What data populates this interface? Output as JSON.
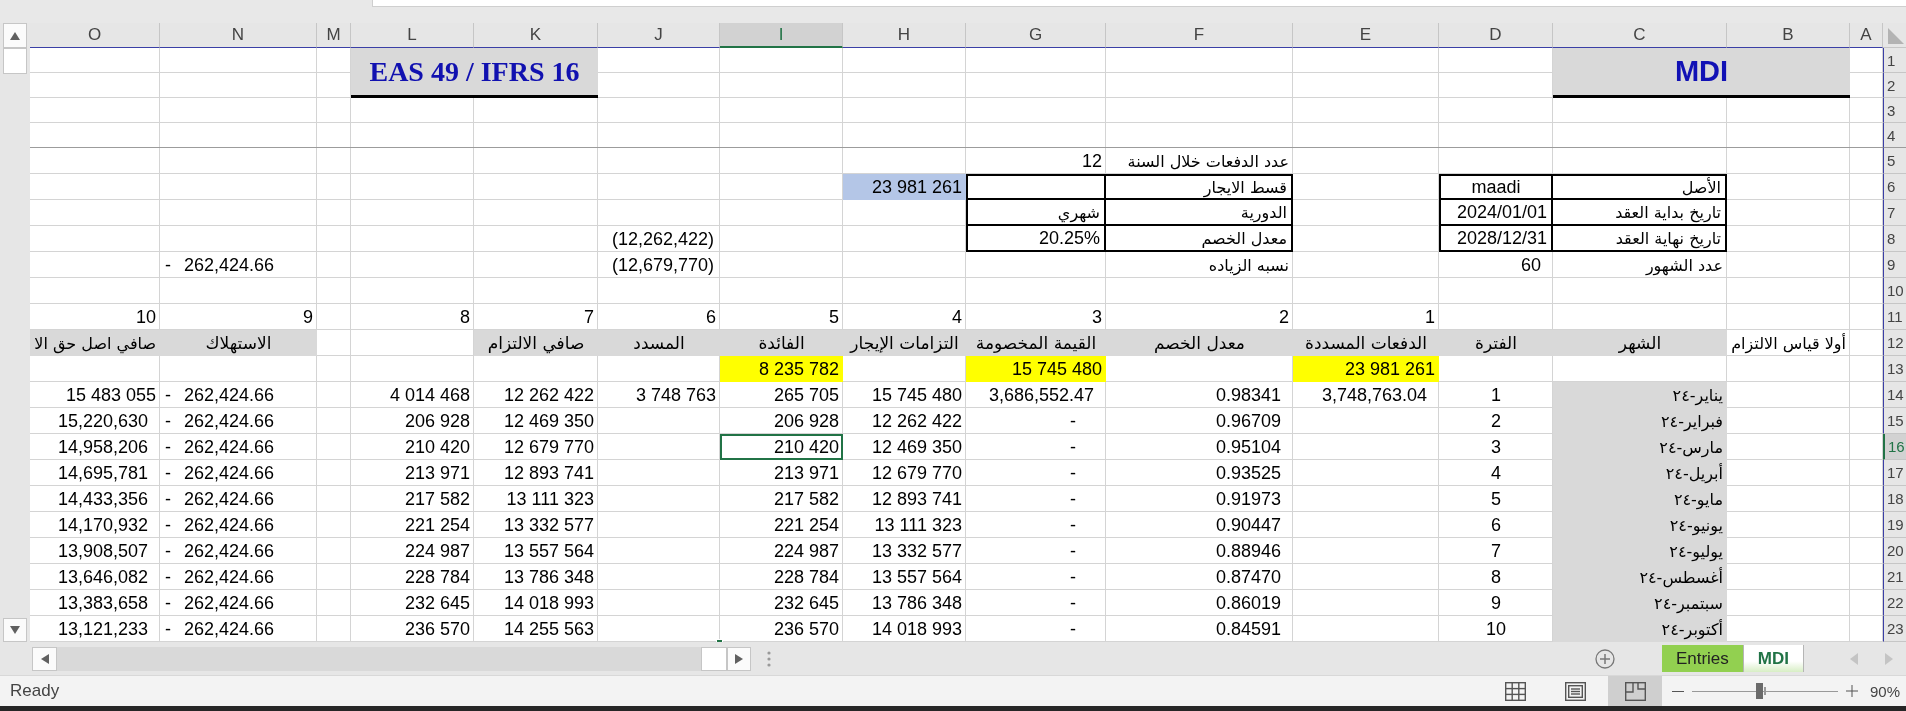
{
  "columns": [
    {
      "label": "O",
      "selected": false
    },
    {
      "label": "N",
      "selected": false
    },
    {
      "label": "M",
      "selected": false
    },
    {
      "label": "L",
      "selected": false
    },
    {
      "label": "K",
      "selected": false
    },
    {
      "label": "J",
      "selected": false
    },
    {
      "label": "I",
      "selected": true
    },
    {
      "label": "H",
      "selected": false
    },
    {
      "label": "G",
      "selected": false
    },
    {
      "label": "F",
      "selected": false
    },
    {
      "label": "E",
      "selected": false
    },
    {
      "label": "D",
      "selected": false
    },
    {
      "label": "C",
      "selected": false
    },
    {
      "label": "B",
      "selected": false
    },
    {
      "label": "A",
      "selected": false
    }
  ],
  "rows": [
    {
      "number": "1",
      "selected": false,
      "cells": {
        "K": {
          "text": "EAS 49 / IFRS 16",
          "kind": "banner",
          "color": "#d9d9d9",
          "selected": false
        },
        "B": {
          "text": "MDI",
          "kind": "title",
          "color": "#d9d9d9",
          "selected": false
        }
      }
    },
    {
      "number": "2",
      "selected": false
    },
    {
      "number": "3",
      "selected": false
    },
    {
      "number": "4",
      "selected": false
    },
    {
      "number": "5",
      "selected": false,
      "cells": {
        "G": {
          "text": "12",
          "kind": "number",
          "selected": false
        },
        "F": {
          "text": "عدد الدفعات خلال السنة",
          "kind": "label",
          "selected": false
        }
      }
    },
    {
      "number": "6",
      "selected": false,
      "cells": {
        "H": {
          "text": "23 981 261",
          "kind": "number",
          "color": "#b4c6e7",
          "selected": false
        },
        "G": {
          "kind": "number",
          "boxed": true,
          "selected": false
        },
        "F": {
          "text": "قسط الايجار",
          "kind": "label",
          "boxed": true,
          "selected": false
        },
        "D": {
          "text": "maadi",
          "kind": "value",
          "boxed": true,
          "selected": false
        },
        "C": {
          "text": "الأصل",
          "kind": "label",
          "boxed": true,
          "selected": false
        }
      }
    },
    {
      "number": "7",
      "selected": false,
      "cells": {
        "G": {
          "text": "شهري",
          "kind": "label",
          "boxed": true,
          "selected": false
        },
        "F": {
          "text": "الدورية",
          "kind": "label",
          "boxed": true,
          "selected": false
        },
        "D": {
          "text": "2024/01/01",
          "kind": "number",
          "boxed": true,
          "selected": false
        },
        "C": {
          "text": "تاريخ بداية العقد",
          "kind": "label",
          "boxed": true,
          "selected": false
        }
      }
    },
    {
      "number": "8",
      "selected": false,
      "cells": {
        "J": {
          "text": "(12,262,422)",
          "kind": "bracketed",
          "selected": false
        },
        "G": {
          "text": "20.25%",
          "kind": "number",
          "boxed": true,
          "selected": false
        },
        "F": {
          "text": "معدل الخصم",
          "kind": "label",
          "boxed": true,
          "selected": false
        },
        "D": {
          "text": "2028/12/31",
          "kind": "number",
          "boxed": true,
          "selected": false
        },
        "C": {
          "text": "تاريخ نهاية العقد",
          "kind": "label",
          "boxed": true,
          "selected": false
        }
      }
    },
    {
      "number": "9",
      "selected": false,
      "cells": {
        "N": {
          "text": "- 262,424.66",
          "kind": "accounting",
          "selected": false
        },
        "J": {
          "text": "(12,679,770)",
          "kind": "bracketed",
          "selected": false
        },
        "F": {
          "text": "نسبه الزياده",
          "kind": "label",
          "selected": false
        },
        "D": {
          "text": "60",
          "kind": "amount",
          "selected": false
        },
        "C": {
          "text": "عدد الشهور",
          "kind": "label",
          "selected": false
        }
      }
    },
    {
      "number": "10",
      "selected": false
    },
    {
      "number": "11",
      "selected": false,
      "cells": {
        "O": {
          "text": "10",
          "kind": "number",
          "selected": false
        },
        "N": {
          "text": "9",
          "kind": "number",
          "selected": false
        },
        "L": {
          "text": "8",
          "kind": "number",
          "selected": false
        },
        "K": {
          "text": "7",
          "kind": "number",
          "selected": false
        },
        "J": {
          "text": "6",
          "kind": "number",
          "selected": false
        },
        "I": {
          "text": "5",
          "kind": "number",
          "selected": false
        },
        "H": {
          "text": "4",
          "kind": "number",
          "selected": false
        },
        "G": {
          "text": "3",
          "kind": "number",
          "selected": false
        },
        "F": {
          "text": "2",
          "kind": "number",
          "selected": false
        },
        "E": {
          "text": "1",
          "kind": "number",
          "selected": false
        }
      }
    },
    {
      "number": "12",
      "selected": false,
      "cells": {
        "O": {
          "text": "صافي اصل حق الا",
          "kind": "label",
          "color": "#d9d9d9",
          "selected": false
        },
        "N": {
          "text": "الاستهلاك",
          "kind": "header",
          "color": "#d9d9d9",
          "selected": false
        },
        "K": {
          "text": "صافي الالتزام",
          "kind": "header",
          "color": "#d9d9d9",
          "selected": false
        },
        "J": {
          "text": "المسدد",
          "kind": "header",
          "color": "#d9d9d9",
          "selected": false
        },
        "I": {
          "text": "الفائدة",
          "kind": "header",
          "color": "#d9d9d9",
          "selected": false
        },
        "H": {
          "text": "التزامات الإيجار",
          "kind": "header",
          "color": "#d9d9d9",
          "selected": false
        },
        "G": {
          "text": "القيمة المخصومة",
          "kind": "header",
          "color": "#d9d9d9",
          "selected": false
        },
        "F": {
          "text": "معدل الخصم",
          "kind": "header",
          "color": "#d9d9d9",
          "selected": false
        },
        "E": {
          "text": "الدفعات المسددة",
          "kind": "header",
          "color": "#d9d9d9",
          "selected": false
        },
        "D": {
          "text": "الفترة",
          "kind": "header",
          "color": "#d9d9d9",
          "selected": false
        },
        "C": {
          "text": "الشهر",
          "kind": "header",
          "color": "#d9d9d9",
          "selected": false
        },
        "B": {
          "text": "أولا قياس الالتزام",
          "kind": "label",
          "selected": false
        }
      }
    },
    {
      "number": "13",
      "selected": false,
      "cells": {
        "I": {
          "text": "8 235 782",
          "kind": "number",
          "color": "#ffff00",
          "selected": false
        },
        "G": {
          "text": "15 745 480",
          "kind": "number",
          "color": "#ffff00",
          "selected": false
        },
        "E": {
          "text": "23 981 261",
          "kind": "number",
          "color": "#ffff00",
          "selected": false
        }
      }
    },
    {
      "number": "14",
      "selected": false,
      "cells": {
        "O": {
          "text": "15 483 055",
          "kind": "number",
          "selected": false
        },
        "N": {
          "text": "- 262,424.66",
          "kind": "accounting",
          "selected": false
        },
        "L": {
          "text": "4 014 468",
          "kind": "number",
          "selected": false
        },
        "K": {
          "text": "12 262 422",
          "kind": "number",
          "selected": false
        },
        "J": {
          "text": "3 748 763",
          "kind": "number",
          "selected": false
        },
        "I": {
          "text": "265 705",
          "kind": "number",
          "selected": false
        },
        "H": {
          "text": "15 745 480",
          "kind": "number",
          "selected": false
        },
        "G": {
          "text": "3,686,552.47",
          "kind": "amount",
          "selected": false
        },
        "F": {
          "text": "0.98341",
          "kind": "amount",
          "selected": false
        },
        "E": {
          "text": "3,748,763.04",
          "kind": "amount",
          "selected": false
        },
        "D": {
          "text": "1",
          "kind": "value",
          "selected": false
        },
        "C": {
          "text": "يناير-٢٤",
          "kind": "label",
          "color": "#d9d9d9",
          "selected": false
        }
      }
    },
    {
      "number": "15",
      "selected": false,
      "cells": {
        "O": {
          "text": "15,220,630",
          "kind": "amount",
          "selected": false
        },
        "N": {
          "text": "- 262,424.66",
          "kind": "accounting",
          "selected": false
        },
        "L": {
          "text": "206 928",
          "kind": "number",
          "selected": false
        },
        "K": {
          "text": "12 469 350",
          "kind": "number",
          "selected": false
        },
        "I": {
          "text": "206 928",
          "kind": "number",
          "selected": false
        },
        "H": {
          "text": "12 262 422",
          "kind": "number",
          "selected": false
        },
        "G": {
          "text": "-",
          "kind": "dash",
          "selected": false
        },
        "F": {
          "text": "0.96709",
          "kind": "amount",
          "selected": false
        },
        "D": {
          "text": "2",
          "kind": "value",
          "selected": false
        },
        "C": {
          "text": "فبراير-٢٤",
          "kind": "label",
          "color": "#d9d9d9",
          "selected": false
        }
      }
    },
    {
      "number": "16",
      "selected": true,
      "cells": {
        "O": {
          "text": "14,958,206",
          "kind": "amount",
          "selected": false
        },
        "N": {
          "text": "- 262,424.66",
          "kind": "accounting",
          "selected": false
        },
        "L": {
          "text": "210 420",
          "kind": "number",
          "selected": false
        },
        "K": {
          "text": "12 679 770",
          "kind": "number",
          "selected": false
        },
        "I": {
          "text": "210 420",
          "kind": "number",
          "selected": true
        },
        "H": {
          "text": "12 469 350",
          "kind": "number",
          "selected": false
        },
        "G": {
          "text": "-",
          "kind": "dash",
          "selected": false
        },
        "F": {
          "text": "0.95104",
          "kind": "amount",
          "selected": false
        },
        "D": {
          "text": "3",
          "kind": "value",
          "selected": false
        },
        "C": {
          "text": "مارس-٢٤",
          "kind": "label",
          "color": "#d9d9d9",
          "selected": false
        }
      }
    },
    {
      "number": "17",
      "selected": false,
      "cells": {
        "O": {
          "text": "14,695,781",
          "kind": "amount",
          "selected": false
        },
        "N": {
          "text": "- 262,424.66",
          "kind": "accounting",
          "selected": false
        },
        "L": {
          "text": "213 971",
          "kind": "number",
          "selected": false
        },
        "K": {
          "text": "12 893 741",
          "kind": "number",
          "selected": false
        },
        "I": {
          "text": "213 971",
          "kind": "number",
          "selected": false
        },
        "H": {
          "text": "12 679 770",
          "kind": "number",
          "selected": false
        },
        "G": {
          "text": "-",
          "kind": "dash",
          "selected": false
        },
        "F": {
          "text": "0.93525",
          "kind": "amount",
          "selected": false
        },
        "D": {
          "text": "4",
          "kind": "value",
          "selected": false
        },
        "C": {
          "text": "أبريل-٢٤",
          "kind": "label",
          "color": "#d9d9d9",
          "selected": false
        }
      }
    },
    {
      "number": "18",
      "selected": false,
      "cells": {
        "O": {
          "text": "14,433,356",
          "kind": "amount",
          "selected": false
        },
        "N": {
          "text": "- 262,424.66",
          "kind": "accounting",
          "selected": false
        },
        "L": {
          "text": "217 582",
          "kind": "number",
          "selected": false
        },
        "K": {
          "text": "13 111 323",
          "kind": "number",
          "selected": false
        },
        "I": {
          "text": "217 582",
          "kind": "number",
          "selected": false
        },
        "H": {
          "text": "12 893 741",
          "kind": "number",
          "selected": false
        },
        "G": {
          "text": "-",
          "kind": "dash",
          "selected": false
        },
        "F": {
          "text": "0.91973",
          "kind": "amount",
          "selected": false
        },
        "D": {
          "text": "5",
          "kind": "value",
          "selected": false
        },
        "C": {
          "text": "مايو-٢٤",
          "kind": "label",
          "color": "#d9d9d9",
          "selected": false
        }
      }
    },
    {
      "number": "19",
      "selected": false,
      "cells": {
        "O": {
          "text": "14,170,932",
          "kind": "amount",
          "selected": false
        },
        "N": {
          "text": "- 262,424.66",
          "kind": "accounting",
          "selected": false
        },
        "L": {
          "text": "221 254",
          "kind": "number",
          "selected": false
        },
        "K": {
          "text": "13 332 577",
          "kind": "number",
          "selected": false
        },
        "I": {
          "text": "221 254",
          "kind": "number",
          "selected": false
        },
        "H": {
          "text": "13 111 323",
          "kind": "number",
          "selected": false
        },
        "G": {
          "text": "-",
          "kind": "dash",
          "selected": false
        },
        "F": {
          "text": "0.90447",
          "kind": "amount",
          "selected": false
        },
        "D": {
          "text": "6",
          "kind": "value",
          "selected": false
        },
        "C": {
          "text": "يونيو-٢٤",
          "kind": "label",
          "color": "#d9d9d9",
          "selected": false
        }
      }
    },
    {
      "number": "20",
      "selected": false,
      "cells": {
        "O": {
          "text": "13,908,507",
          "kind": "amount",
          "selected": false
        },
        "N": {
          "text": "- 262,424.66",
          "kind": "accounting",
          "selected": false
        },
        "L": {
          "text": "224 987",
          "kind": "number",
          "selected": false
        },
        "K": {
          "text": "13 557 564",
          "kind": "number",
          "selected": false
        },
        "I": {
          "text": "224 987",
          "kind": "number",
          "selected": false
        },
        "H": {
          "text": "13 332 577",
          "kind": "number",
          "selected": false
        },
        "G": {
          "text": "-",
          "kind": "dash",
          "selected": false
        },
        "F": {
          "text": "0.88946",
          "kind": "amount",
          "selected": false
        },
        "D": {
          "text": "7",
          "kind": "value",
          "selected": false
        },
        "C": {
          "text": "يوليو-٢٤",
          "kind": "label",
          "color": "#d9d9d9",
          "selected": false
        }
      }
    },
    {
      "number": "21",
      "selected": false,
      "cells": {
        "O": {
          "text": "13,646,082",
          "kind": "amount",
          "selected": false
        },
        "N": {
          "text": "- 262,424.66",
          "kind": "accounting",
          "selected": false
        },
        "L": {
          "text": "228 784",
          "kind": "number",
          "selected": false
        },
        "K": {
          "text": "13 786 348",
          "kind": "number",
          "selected": false
        },
        "I": {
          "text": "228 784",
          "kind": "number",
          "selected": false
        },
        "H": {
          "text": "13 557 564",
          "kind": "number",
          "selected": false
        },
        "G": {
          "text": "-",
          "kind": "dash",
          "selected": false
        },
        "F": {
          "text": "0.87470",
          "kind": "amount",
          "selected": false
        },
        "D": {
          "text": "8",
          "kind": "value",
          "selected": false
        },
        "C": {
          "text": "أغسطس-٢٤",
          "kind": "label",
          "color": "#d9d9d9",
          "selected": false
        }
      }
    },
    {
      "number": "22",
      "selected": false,
      "cells": {
        "O": {
          "text": "13,383,658",
          "kind": "amount",
          "selected": false
        },
        "N": {
          "text": "- 262,424.66",
          "kind": "accounting",
          "selected": false
        },
        "L": {
          "text": "232 645",
          "kind": "number",
          "selected": false
        },
        "K": {
          "text": "14 018 993",
          "kind": "number",
          "selected": false
        },
        "I": {
          "text": "232 645",
          "kind": "number",
          "selected": false
        },
        "H": {
          "text": "13 786 348",
          "kind": "number",
          "selected": false
        },
        "G": {
          "text": "-",
          "kind": "dash",
          "selected": false
        },
        "F": {
          "text": "0.86019",
          "kind": "amount",
          "selected": false
        },
        "D": {
          "text": "9",
          "kind": "value",
          "selected": false
        },
        "C": {
          "text": "سبتمبر-٢٤",
          "kind": "label",
          "color": "#d9d9d9",
          "selected": false
        }
      }
    },
    {
      "number": "23",
      "selected": false,
      "cells": {
        "O": {
          "text": "13,121,233",
          "kind": "amount",
          "selected": false
        },
        "N": {
          "text": "- 262,424.66",
          "kind": "accounting",
          "selected": false
        },
        "L": {
          "text": "236 570",
          "kind": "number",
          "selected": false
        },
        "K": {
          "text": "14 255 563",
          "kind": "number",
          "selected": false
        },
        "I": {
          "text": "236 570",
          "kind": "number",
          "selected": false
        },
        "H": {
          "text": "14 018 993",
          "kind": "number",
          "selected": false
        },
        "G": {
          "text": "-",
          "kind": "dash",
          "selected": false
        },
        "F": {
          "text": "0.84591",
          "kind": "amount",
          "selected": false
        },
        "D": {
          "text": "10",
          "kind": "value",
          "selected": false
        },
        "C": {
          "text": "أكتوبر-٢٤",
          "kind": "label",
          "color": "#d9d9d9",
          "selected": false
        }
      }
    }
  ],
  "sheet_tabs": [
    {
      "label": "Entries",
      "selected": false,
      "color": "#92d050"
    },
    {
      "label": "MDI",
      "selected": true
    }
  ],
  "status_bar": {
    "text": "Ready",
    "views": [
      {
        "kind": "normal",
        "selected": false
      },
      {
        "kind": "layout",
        "selected": false
      },
      {
        "kind": "pagebreak",
        "selected": true
      }
    ],
    "zoom": {
      "level": 0.46,
      "reading": "90%"
    }
  }
}
